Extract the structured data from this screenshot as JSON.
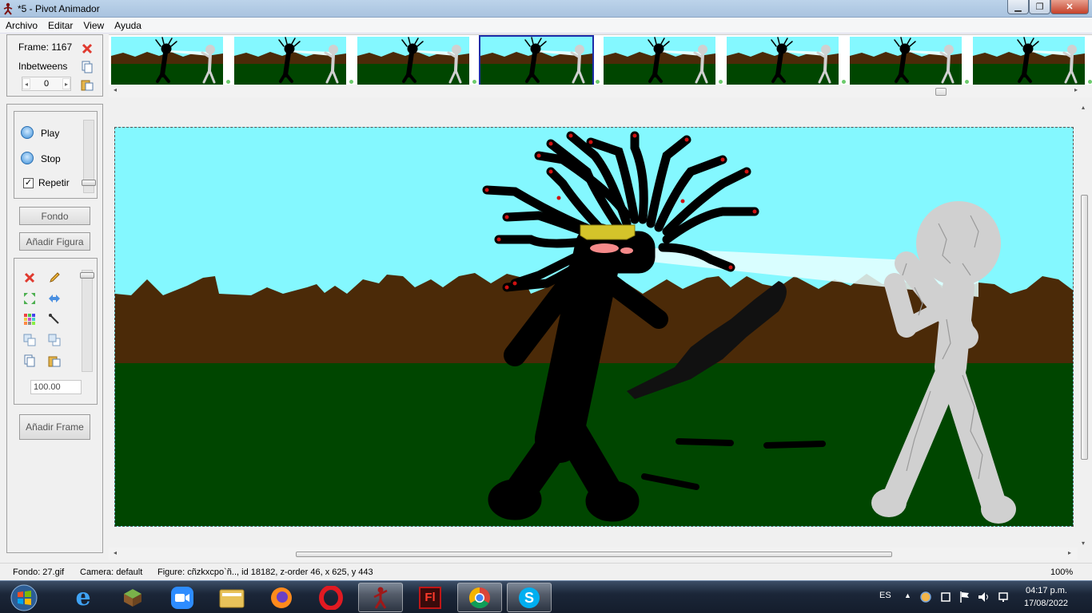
{
  "window": {
    "title": "*5 - Pivot Animador",
    "controls": {
      "minimize": "▁",
      "maximize": "❐",
      "close": "✕"
    }
  },
  "menu": [
    "Archivo",
    "Editar",
    "View",
    "Ayuda"
  ],
  "frame_panel": {
    "frame_label": "Frame: 1167",
    "inbetweens_label": "Inbetweens",
    "inbetweens_value": "0"
  },
  "playback": {
    "play_label": "Play",
    "stop_label": "Stop",
    "repeat_label": "Repetir",
    "repeat_checked": "✓"
  },
  "buttons": {
    "background": "Fondo",
    "add_figure": "Añadir Figura",
    "add_frame": "Añadir Frame"
  },
  "tools": {
    "scale_value": "100.00",
    "icons": [
      "delete-icon",
      "edit-icon",
      "center-icon",
      "flip-icon",
      "color-icon",
      "pick-icon",
      "front-icon",
      "back-icon",
      "copy-icon",
      "paste-icon"
    ]
  },
  "timeline": {
    "frames": 8,
    "selected_index": 3,
    "scroll_position": 0.83
  },
  "status": {
    "background": "Fondo: 27.gif",
    "camera": "Camera: default",
    "figure": "Figure: cñzkxcpo`ñ..,  id 18182,  z-order 46,  x 625, y 443",
    "zoom": "100%"
  },
  "taskbar": {
    "language": "ES",
    "time": "04:17 p.m.",
    "date": "17/08/2022",
    "apps": [
      "start",
      "internet-explorer",
      "minecraft",
      "zoom",
      "file-explorer",
      "firefox",
      "opera",
      "pivot-animator",
      "flash",
      "chrome",
      "skype"
    ]
  },
  "colors": {
    "sky": "#84f8ff",
    "mountains": "#4b2a08",
    "grass": "#004600",
    "selection": "#1e2ca8"
  }
}
